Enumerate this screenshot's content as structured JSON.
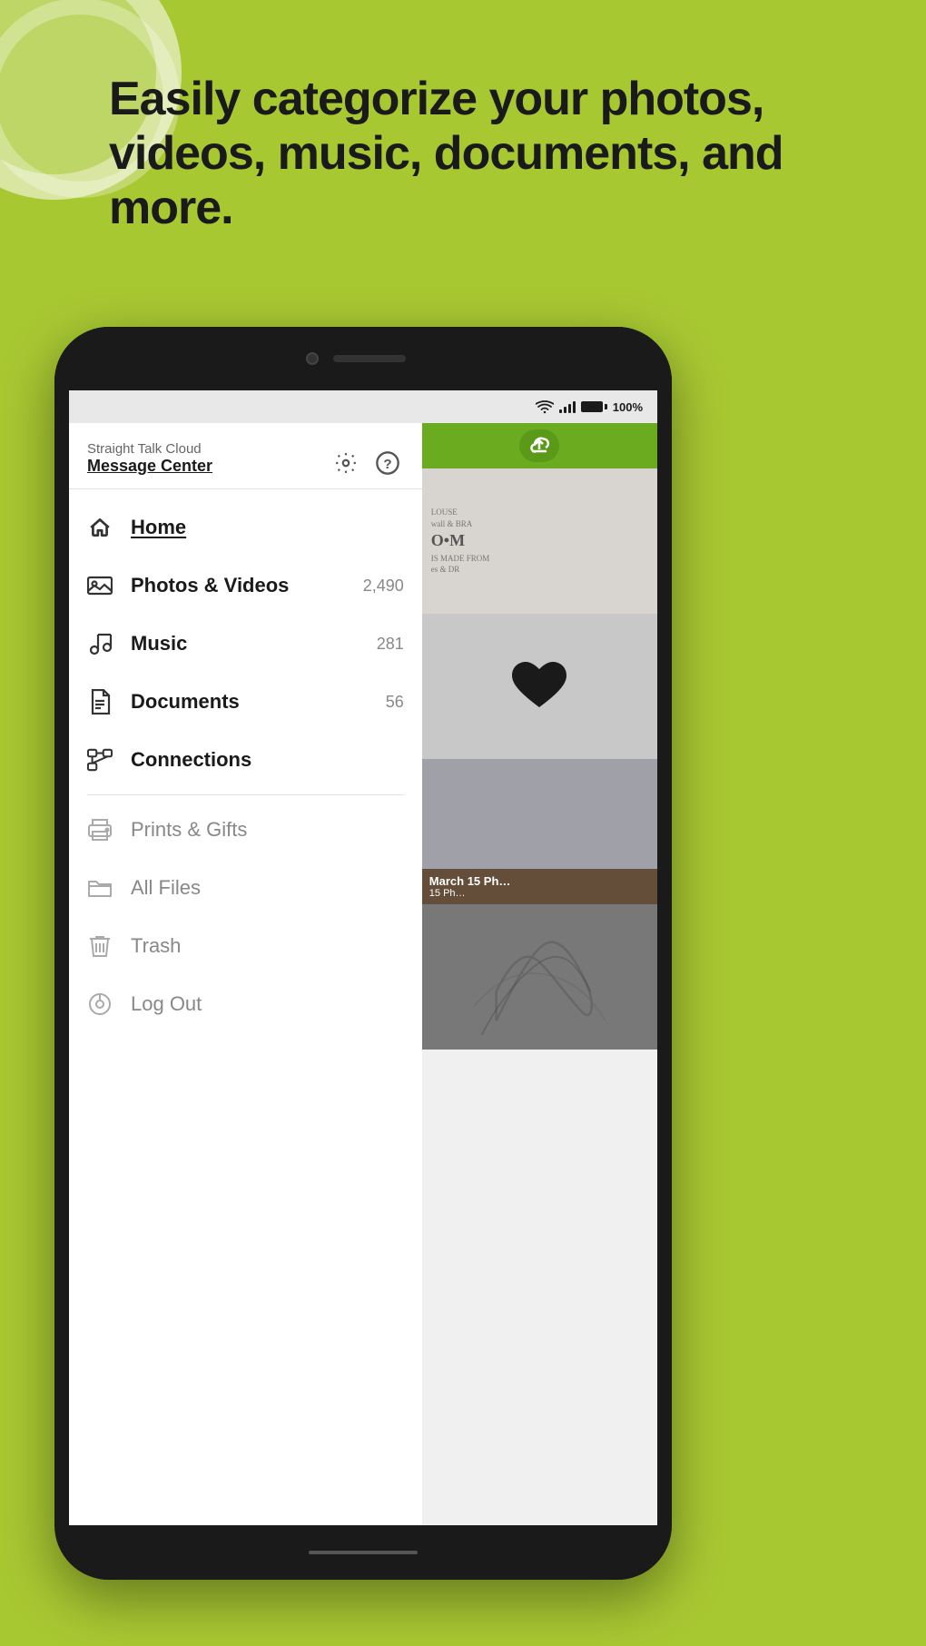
{
  "page": {
    "background_color": "#a8c832"
  },
  "headline": {
    "text": "Easily categorize your photos, videos, music, documents, and more."
  },
  "status_bar": {
    "battery_percent": "100%"
  },
  "app": {
    "brand": "Straight Talk Cloud",
    "subtitle": "Message Center"
  },
  "nav_items": [
    {
      "id": "home",
      "label": "Home",
      "icon": "home-icon",
      "count": "",
      "state": "active"
    },
    {
      "id": "photos-videos",
      "label": "Photos & Videos",
      "icon": "photo-icon",
      "count": "2,490",
      "state": "inactive"
    },
    {
      "id": "music",
      "label": "Music",
      "icon": "music-icon",
      "count": "281",
      "state": "inactive"
    },
    {
      "id": "documents",
      "label": "Documents",
      "icon": "doc-icon",
      "count": "56",
      "state": "inactive"
    },
    {
      "id": "connections",
      "label": "Connections",
      "icon": "connections-icon",
      "count": "",
      "state": "inactive"
    }
  ],
  "nav_secondary": [
    {
      "id": "prints-gifts",
      "label": "Prints & Gifts",
      "icon": "prints-icon"
    },
    {
      "id": "all-files",
      "label": "All Files",
      "icon": "folder-icon"
    },
    {
      "id": "trash",
      "label": "Trash",
      "icon": "trash-icon"
    },
    {
      "id": "logout",
      "label": "Log Out",
      "icon": "logout-icon"
    }
  ],
  "photos": [
    {
      "id": "photo-1",
      "label": "",
      "has_text": true,
      "text_content": "LOUSE\nwall & BRA\nO•M\nIS MADE FROM\nes & DR"
    },
    {
      "id": "photo-2",
      "label": "",
      "has_heart": true
    },
    {
      "id": "photo-3",
      "label": "March\n15 Ph…",
      "has_label": true
    },
    {
      "id": "photo-4",
      "label": ""
    }
  ]
}
